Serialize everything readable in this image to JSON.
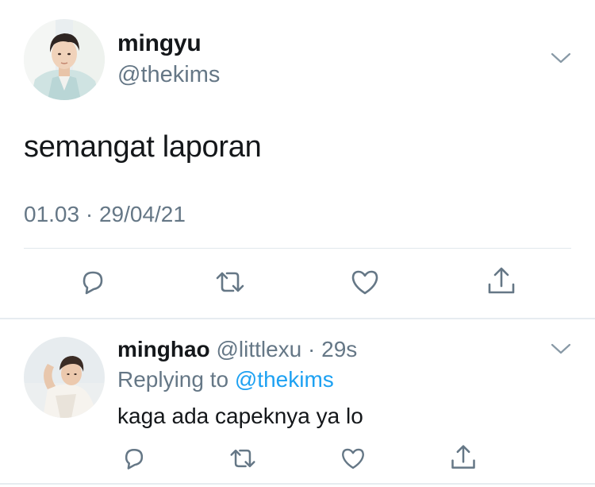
{
  "main_tweet": {
    "display_name": "mingyu",
    "handle": "@thekims",
    "text": "semangat laporan",
    "meta": "01.03 · 29/04/21",
    "avatar_icon": "user-photo-avatar",
    "menu_icon": "chevron-down-icon",
    "actions": [
      "reply-icon",
      "retweet-icon",
      "like-icon",
      "share-icon"
    ]
  },
  "reply_tweet": {
    "display_name": "minghao",
    "handle": "@littlexu",
    "separator": " · ",
    "time": "29s",
    "replying_prefix": "Replying to ",
    "replying_to": "@thekims",
    "text": "kaga ada capeknya ya lo",
    "avatar_icon": "user-photo-avatar",
    "menu_icon": "chevron-down-icon",
    "actions": [
      "reply-icon",
      "retweet-icon",
      "like-icon",
      "share-icon"
    ]
  },
  "colors": {
    "text_primary": "#14171a",
    "text_secondary": "#657786",
    "link": "#1da1f2",
    "divider": "#e1e8ed",
    "icon": "#657786"
  }
}
